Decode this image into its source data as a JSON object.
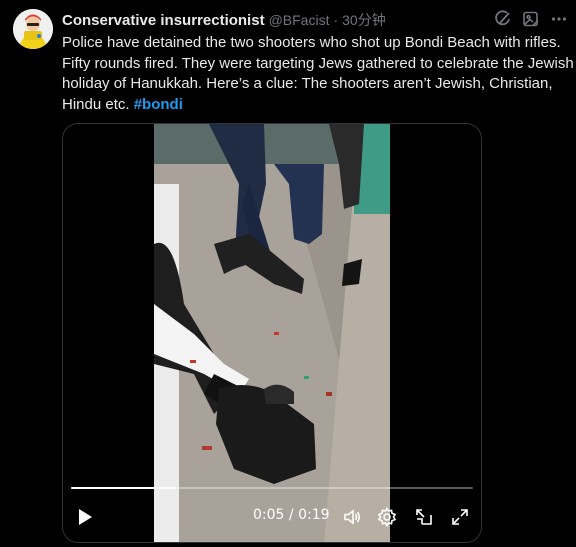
{
  "author": {
    "display_name": "Conservative insurrectionist",
    "handle": "@BFacist",
    "separator": "·",
    "time_ago": "30分钟",
    "avatar_icon": "yellow-character-avatar-icon"
  },
  "actions": {
    "grok_icon": "grok-icon",
    "image_icon": "image-edit-icon",
    "more_icon": "more-dots-icon"
  },
  "tweet": {
    "text": "Police have detained the two shooters who shot up Bondi Beach with rifles. Fifty rounds fired. They were targeting Jews gathered to celebrate the Jewish holiday of Hanukkah. Here’s a clue: The shooters aren’t Jewish, Christian, Hindu etc.",
    "hashtag": "#bondi"
  },
  "video": {
    "current_time": "0:05",
    "duration": "0:19",
    "time_separator": " / ",
    "progress_fraction": 0.26,
    "play_icon": "play-icon",
    "volume_icon": "volume-icon",
    "settings_icon": "settings-gear-icon",
    "popout_icon": "popout-icon",
    "fullscreen_icon": "fullscreen-icon"
  },
  "colors": {
    "background": "#000000",
    "text": "#e7e9ea",
    "muted": "#71767b",
    "link": "#1d9bf0"
  }
}
